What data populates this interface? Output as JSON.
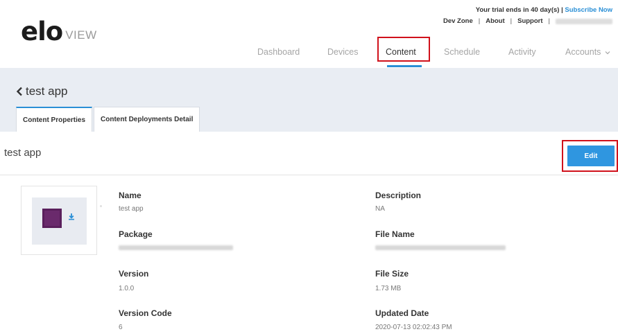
{
  "header": {
    "logo_main": "elo",
    "logo_sub": "VIEW",
    "trial_text": "Your trial ends in 40 day(s) | ",
    "subscribe_label": "Subscribe Now",
    "util_links": [
      "Dev Zone",
      "About",
      "Support"
    ],
    "separator": "|"
  },
  "nav": {
    "items": [
      "Dashboard",
      "Devices",
      "Content",
      "Schedule",
      "Activity",
      "Accounts"
    ],
    "active": "Content"
  },
  "page": {
    "back_title": "test app",
    "tabs": [
      "Content Properties",
      "Content Deployments Detail"
    ],
    "active_tab": "Content Properties",
    "title": "test app",
    "edit_label": "Edit"
  },
  "details": {
    "name_label": "Name",
    "name_value": "test app",
    "package_label": "Package",
    "version_label": "Version",
    "version_value": "1.0.0",
    "version_code_label": "Version Code",
    "version_code_value": "6",
    "description_label": "Description",
    "description_value": "NA",
    "file_name_label": "File Name",
    "file_size_label": "File Size",
    "file_size_value": "1.73 MB",
    "updated_date_label": "Updated Date",
    "updated_date_value": "2020-07-13 02:02:43 PM"
  },
  "colors": {
    "accent": "#2a8fd6",
    "highlight": "#d0111b",
    "band": "#e9edf3",
    "app_icon": "#6a2a6c"
  },
  "icons": [
    "back-chevron-icon",
    "download-icon",
    "chevron-down-icon"
  ]
}
